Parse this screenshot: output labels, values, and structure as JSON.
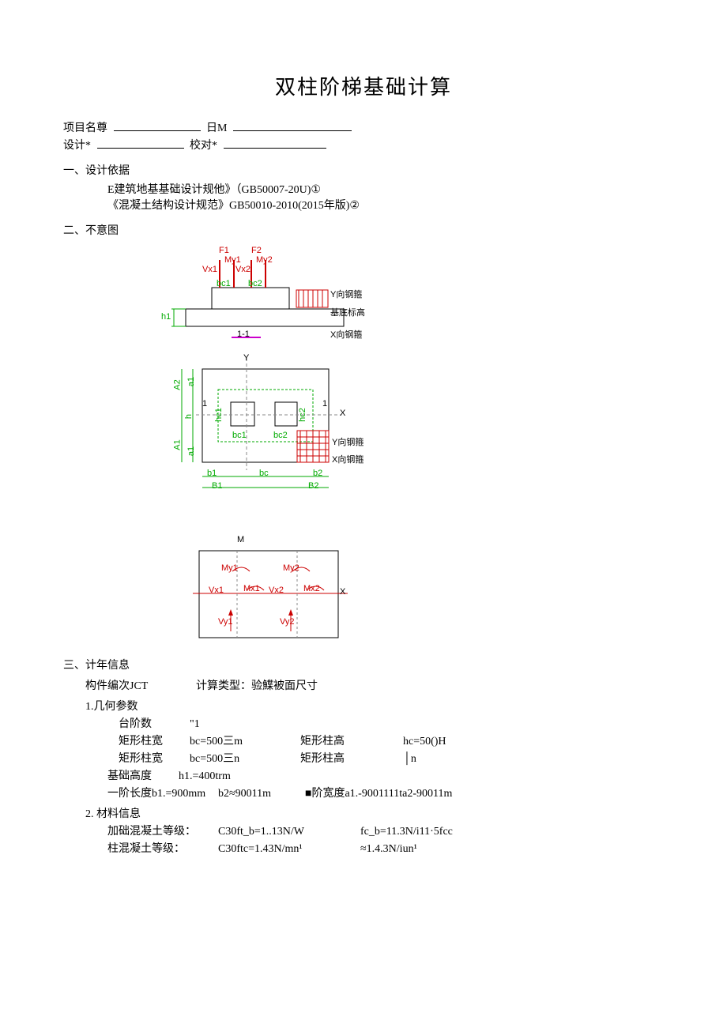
{
  "title": "双柱阶梯基础计算",
  "meta": {
    "project_label": "项目名尊",
    "date_label": "日M",
    "designer_label": "设计*",
    "checker_label": "校对*"
  },
  "s1": {
    "head": "一、设计依据",
    "line1": "E建筑地基基础设计规他》（GB50007-20U)①",
    "line2": "《混凝土结构设计规范》GB50010-2010(2015年版)②"
  },
  "s2": {
    "head": "二、不意图"
  },
  "fig1_labels": {
    "F1": "F1",
    "F2": "F2",
    "Vx1": "Vx1",
    "Vx2": "Vx2",
    "My1": "My1",
    "My2": "My2",
    "bc1": "bc1",
    "bc2": "bc2",
    "h1": "h1",
    "cut": "1-1",
    "yrebar": "Y向钢箍",
    "jidi": "基底标高",
    "xrebar": "X向钢箍"
  },
  "fig2_labels": {
    "Y": "Y",
    "X": "X",
    "A1": "A1",
    "A2": "A2",
    "a1t": "a1",
    "a1b": "a1",
    "h": "h",
    "one_l": "1",
    "one_r": "1",
    "hc1": "hc1",
    "hc2": "hc2",
    "bc1": "bc1",
    "bc2": "bc2",
    "b1": "b1",
    "b2": "b2",
    "bc": "bc",
    "B1": "B1",
    "B2": "B2",
    "yrebar": "Y向钢箍",
    "xrebar": "X向钢箍"
  },
  "fig3_labels": {
    "M": "M",
    "My1": "My1",
    "My2": "My2",
    "Vx1": "Vx1",
    "Vx2": "Vx2",
    "Mx1": "Mx1",
    "Mx2": "Mx2",
    "Vy1": "Vy1",
    "Vy2": "Vy2",
    "X": "X"
  },
  "s3": {
    "head": "三、计年信息",
    "comp_no_label": "构件编次JCT",
    "calc_type_label": "计算类型：验鰈被面尺寸",
    "geom_head": "1.几何参数",
    "steps_label": "台阶数",
    "steps_val": "\"1",
    "rect_w_label": "矩形柱宽",
    "bc1": "bc=500三m",
    "bc2": "bc=500三n",
    "rect_h_label": "矩形柱高",
    "hc1": "hc=50()H",
    "hc2": "│n",
    "found_h_label": "基础高度",
    "found_h_val": "h1.=400trm",
    "step_len_label": "一阶长度b1.=900mm",
    "b2_val": "b2≈90011m",
    "step_w_label": "■阶宽度a1.-9001111ta2-90011m",
    "mat_head": "2. 材料信息",
    "found_conc_label": "加础混凝土等级：",
    "found_conc_val": "C30ft_b=1..13N/W",
    "fc_b_val": "fc_b=11.3N/i11·5fcc",
    "col_conc_label": "柱混凝土等级：",
    "col_conc_val": "C30ftc=1.43N/mn¹",
    "approx_val": "≈1.4.3N/iun¹"
  }
}
